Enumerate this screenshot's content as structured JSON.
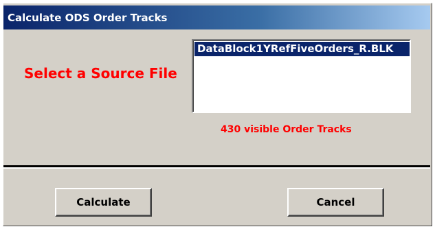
{
  "window": {
    "title": "Calculate ODS Order Tracks"
  },
  "source": {
    "label": "Select a Source File",
    "files": [
      "DataBlock1YRefFiveOrders_R.BLK"
    ],
    "selected_index": 0
  },
  "status": {
    "visible_tracks": "430 visible Order Tracks"
  },
  "buttons": {
    "calculate": "Calculate",
    "cancel": "Cancel"
  },
  "colors": {
    "titlebar_start": "#0a246a",
    "titlebar_end": "#a6caf0",
    "accent_text": "#ff0000",
    "selection": "#0a246a",
    "face": "#d4d0c8"
  }
}
